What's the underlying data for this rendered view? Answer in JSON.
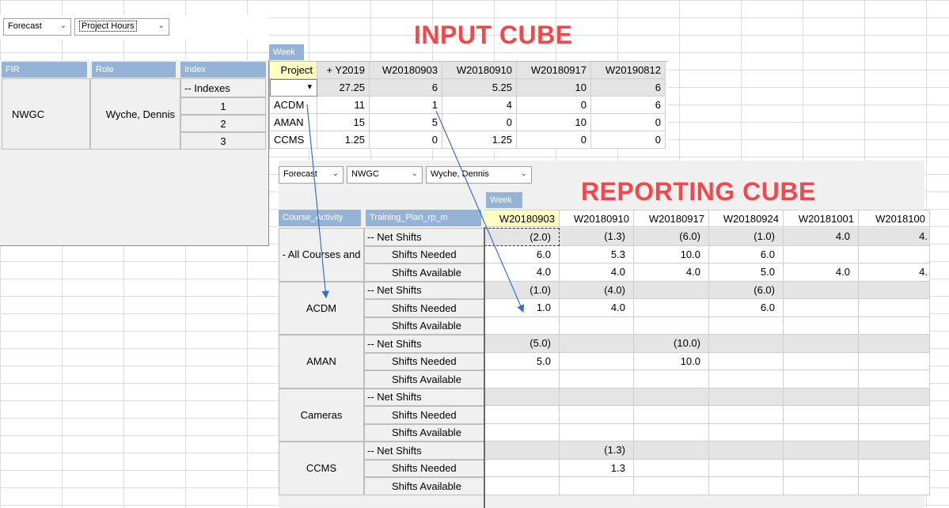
{
  "titles": {
    "input": "INPUT CUBE",
    "reporting": "REPORTING CUBE"
  },
  "input_cube": {
    "combos": [
      "Forecast",
      "Project Hours"
    ],
    "week_tab": "Week",
    "dim_headers": [
      "FIR",
      "Role",
      "Index"
    ],
    "fir": "NWGC",
    "role": "Wyche, Dennis",
    "indexes": [
      "-- Indexes",
      "1",
      "2",
      "3"
    ],
    "col_headers": [
      "Project",
      "+ Y2019",
      "W20180903",
      "W20180910",
      "W20180917",
      "W20190812"
    ],
    "rows": [
      {
        "label": "",
        "values": [
          "27.25",
          "6",
          "5.25",
          "10",
          "6"
        ]
      },
      {
        "label": "ACDM",
        "values": [
          "11",
          "1",
          "4",
          "0",
          "6"
        ]
      },
      {
        "label": "AMAN",
        "values": [
          "15",
          "5",
          "0",
          "10",
          "0"
        ]
      },
      {
        "label": "CCMS",
        "values": [
          "1.25",
          "0",
          "1.25",
          "0",
          "0"
        ]
      }
    ],
    "dropdown_glyph": "▾"
  },
  "reporting_cube": {
    "combos": [
      "Forecast",
      "NWGC",
      "Wyche, Dennis"
    ],
    "week_tab": "Week",
    "dim_headers": [
      "Course_Activity",
      "Training_Plan_rp_m"
    ],
    "col_headers": [
      "W20180903",
      "W20180910",
      "W20180917",
      "W20180924",
      "W20181001",
      "W2018100"
    ],
    "groups": [
      {
        "name": "- All Courses and",
        "rows": [
          {
            "label": "-- Net Shifts",
            "values": [
              "(2.0)",
              "(1.3)",
              "(6.0)",
              "(1.0)",
              "4.0",
              "4."
            ]
          },
          {
            "label": "Shifts Needed",
            "values": [
              "6.0",
              "5.3",
              "10.0",
              "6.0",
              "",
              ""
            ]
          },
          {
            "label": "Shifts Available",
            "values": [
              "4.0",
              "4.0",
              "4.0",
              "5.0",
              "4.0",
              "4."
            ]
          }
        ]
      },
      {
        "name": "ACDM",
        "rows": [
          {
            "label": "-- Net Shifts",
            "values": [
              "(1.0)",
              "(4.0)",
              "",
              "(6.0)",
              "",
              ""
            ]
          },
          {
            "label": "Shifts Needed",
            "values": [
              "1.0",
              "4.0",
              "",
              "6.0",
              "",
              ""
            ]
          },
          {
            "label": "Shifts Available",
            "values": [
              "",
              "",
              "",
              "",
              "",
              ""
            ]
          }
        ]
      },
      {
        "name": "AMAN",
        "rows": [
          {
            "label": "-- Net Shifts",
            "values": [
              "(5.0)",
              "",
              "(10.0)",
              "",
              "",
              ""
            ]
          },
          {
            "label": "Shifts Needed",
            "values": [
              "5.0",
              "",
              "10.0",
              "",
              "",
              ""
            ]
          },
          {
            "label": "Shifts Available",
            "values": [
              "",
              "",
              "",
              "",
              "",
              ""
            ]
          }
        ]
      },
      {
        "name": "Cameras",
        "rows": [
          {
            "label": "-- Net Shifts",
            "values": [
              "",
              "",
              "",
              "",
              "",
              ""
            ]
          },
          {
            "label": "Shifts Needed",
            "values": [
              "",
              "",
              "",
              "",
              "",
              ""
            ]
          },
          {
            "label": "Shifts Available",
            "values": [
              "",
              "",
              "",
              "",
              "",
              ""
            ]
          }
        ]
      },
      {
        "name": "CCMS",
        "rows": [
          {
            "label": "-- Net Shifts",
            "values": [
              "",
              "(1.3)",
              "",
              "",
              "",
              ""
            ]
          },
          {
            "label": "Shifts Needed",
            "values": [
              "",
              "1.3",
              "",
              "",
              "",
              ""
            ]
          },
          {
            "label": "Shifts Available",
            "values": [
              "",
              "",
              "",
              "",
              "",
              ""
            ]
          }
        ]
      }
    ]
  },
  "colors": {
    "accent_red": "#f2484b",
    "header_blue": "#95b3d7",
    "arrow_blue": "#3a6fc9"
  }
}
